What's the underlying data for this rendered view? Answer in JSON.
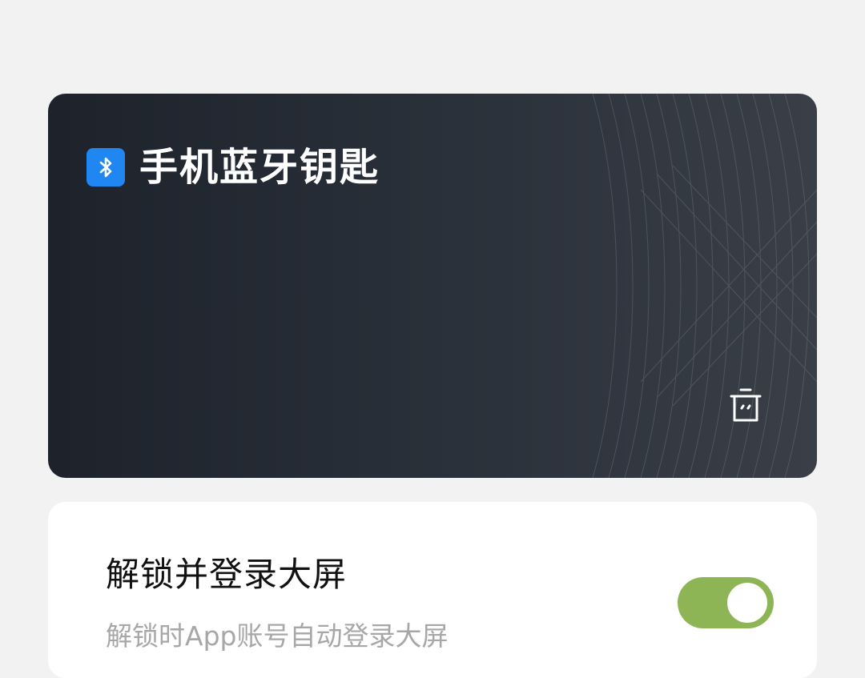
{
  "key_card": {
    "title": "手机蓝牙钥匙",
    "badge_icon": "bluetooth-icon",
    "delete_icon": "trash-icon",
    "badge_color": "#1f86f2",
    "background_color": "#262c35"
  },
  "setting": {
    "title": "解锁并登录大屏",
    "description": "解锁时App账号自动登录大屏",
    "toggle_state": "on",
    "toggle_color": "#8db556"
  }
}
